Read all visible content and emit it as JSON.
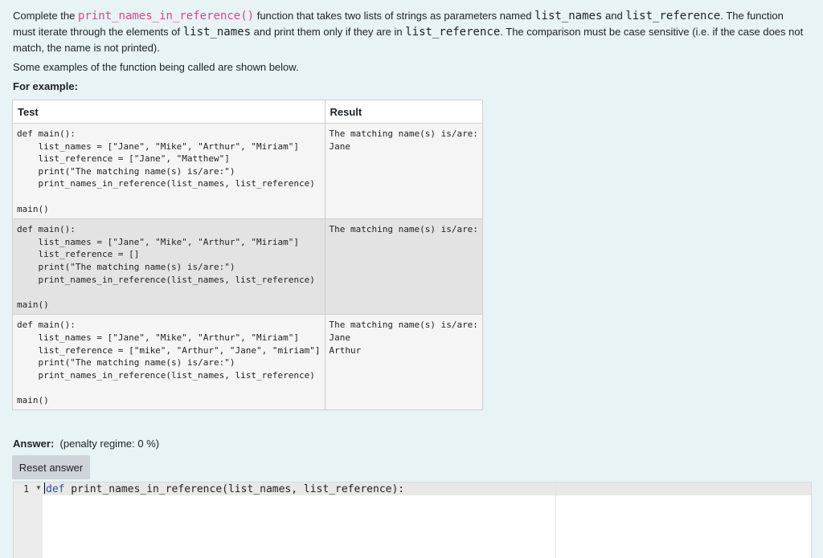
{
  "question": {
    "p1_a": "Complete the ",
    "func_name": "print_names_in_reference()",
    "p1_b": " function that takes two lists of strings as parameters named ",
    "param1": "list_names",
    "p1_c": " and ",
    "param2": "list_reference",
    "p1_d": ". The function must iterate through the elements of ",
    "param1b": "list_names",
    "p1_e": " and print them only if they are in ",
    "param2b": "list_reference",
    "p1_f": ". The comparison must be case sensitive (i.e. if the case does not match, the name is not printed).",
    "examples_lead": "Some examples of the function being called are shown below.",
    "for_example": "For example:"
  },
  "table": {
    "headers": [
      "Test",
      "Result"
    ],
    "rows": [
      {
        "test": "def main():\n    list_names = [\"Jane\", \"Mike\", \"Arthur\", \"Miriam\"]\n    list_reference = [\"Jane\", \"Matthew\"]\n    print(\"The matching name(s) is/are:\")\n    print_names_in_reference(list_names, list_reference)\n\nmain()",
        "result": "The matching name(s) is/are:\nJane"
      },
      {
        "test": "def main():\n    list_names = [\"Jane\", \"Mike\", \"Arthur\", \"Miriam\"]\n    list_reference = []\n    print(\"The matching name(s) is/are:\")\n    print_names_in_reference(list_names, list_reference)\n\nmain()",
        "result": "The matching name(s) is/are:"
      },
      {
        "test": "def main():\n    list_names = [\"Jane\", \"Mike\", \"Arthur\", \"Miriam\"]\n    list_reference = [\"mike\", \"Arthur\", \"Jane\", \"miriam\"]\n    print(\"The matching name(s) is/are:\")\n    print_names_in_reference(list_names, list_reference)\n\nmain()",
        "result": "The matching name(s) is/are:\nJane\nArthur"
      }
    ]
  },
  "answer": {
    "label": "Answer:",
    "penalty": "(penalty regime: 0 %)",
    "reset_label": "Reset answer"
  },
  "editor": {
    "line_number": "1",
    "keyword": "def",
    "code_rest": " print_names_in_reference(list_names, list_reference):"
  },
  "icons": {
    "fold": "fold-arrow-icon"
  },
  "colors": {
    "background": "#e7f3f5",
    "code_highlight": "#e83e8c",
    "keyword": "#2f4dc9",
    "button": "#ced4da"
  }
}
